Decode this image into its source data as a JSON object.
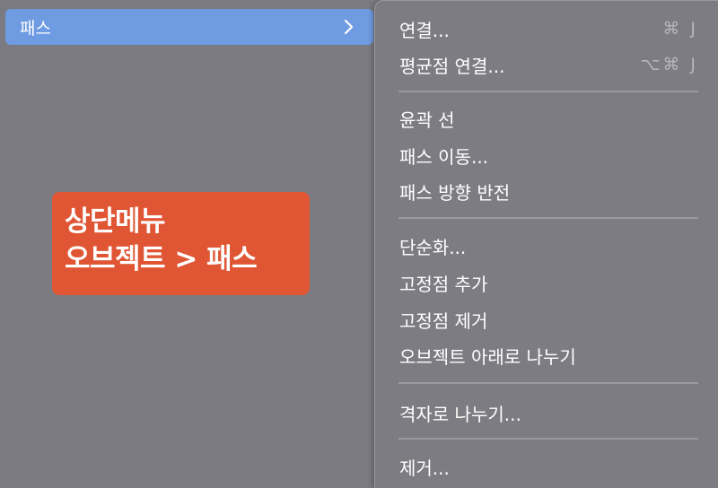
{
  "parent_menu": {
    "label": "패스",
    "chevron_icon": "chevron-right-icon",
    "highlight_color": "#6f9be2"
  },
  "callout": {
    "line1": "상단메뉴",
    "line2": "오브젝트 > 패스",
    "color": "#e05634"
  },
  "submenu": {
    "items": [
      {
        "label": "연결...",
        "shortcut": "⌘ J"
      },
      {
        "label": "평균점 연결...",
        "shortcut": "⌥⌘ J"
      },
      {
        "label": "윤곽 선"
      },
      {
        "label": "패스 이동..."
      },
      {
        "label": "패스 방향 반전"
      },
      {
        "label": "단순화..."
      },
      {
        "label": "고정점 추가"
      },
      {
        "label": "고정점 제거"
      },
      {
        "label": "오브젝트 아래로 나누기"
      },
      {
        "label": "격자로 나누기..."
      },
      {
        "label": "제거..."
      }
    ]
  }
}
